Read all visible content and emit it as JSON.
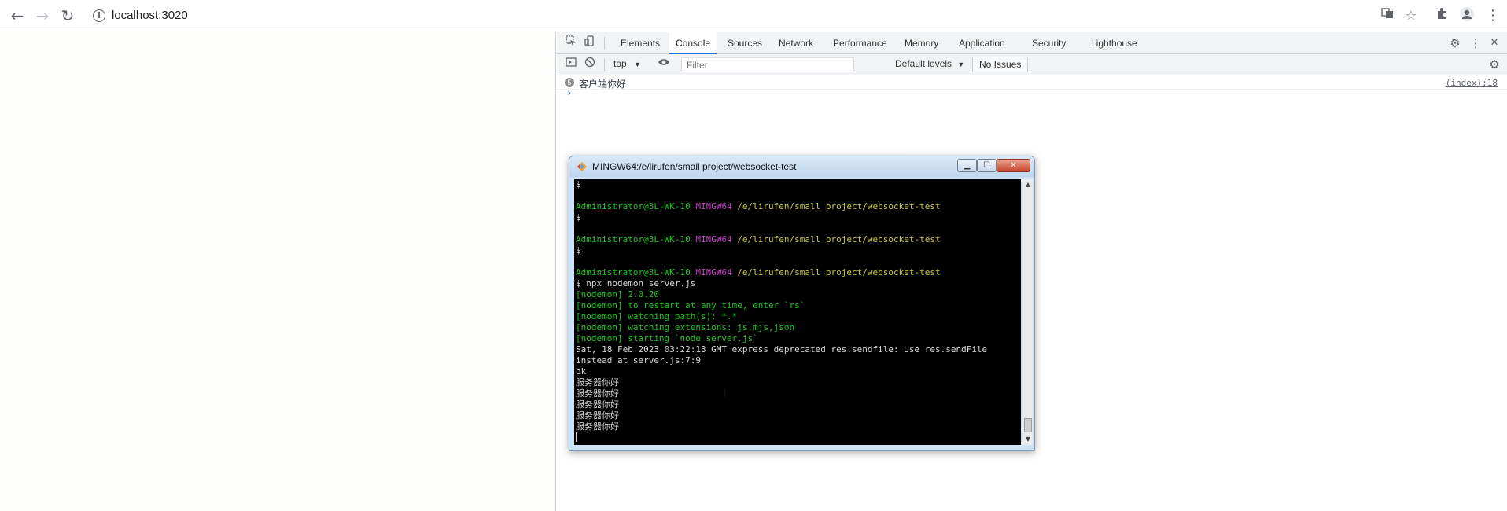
{
  "browser": {
    "url": "localhost:3020",
    "back_icon": "←",
    "forward_icon": "→",
    "reload_icon": "↻"
  },
  "devtools": {
    "tabs": [
      "Elements",
      "Console",
      "Sources",
      "Network",
      "Performance",
      "Memory",
      "Application",
      "Security",
      "Lighthouse"
    ],
    "active_tab": "Console",
    "context": "top",
    "filter_placeholder": "Filter",
    "levels": "Default levels",
    "issues": "No Issues",
    "console_messages": [
      {
        "count": "5",
        "text": "客户端你好",
        "source": "(index):18"
      }
    ],
    "prompt": "›"
  },
  "terminal": {
    "title": "MINGW64:/e/lirufen/small project/websocket-test",
    "prompt_user": "Administrator@3L-WK-10",
    "prompt_shell": "MINGW64",
    "prompt_path": "/e/lirufen/small project/websocket-test",
    "lines": {
      "l01": "$",
      "l03": "$",
      "l05": "$",
      "l07": "$ npx nodemon server.js",
      "l08": "[nodemon] 2.0.20",
      "l09": "[nodemon] to restart at any time, enter `rs`",
      "l10": "[nodemon] watching path(s): *.*",
      "l11": "[nodemon] watching extensions: js,mjs,json",
      "l12": "[nodemon] starting `node server.js`",
      "l13": "Sat, 18 Feb 2023 03:22:13 GMT express deprecated res.sendfile: Use res.sendFile",
      "l14": "instead at server.js:7:9",
      "l15": "ok",
      "l16": "服务器你好",
      "l17": "服务器你好",
      "l18": "服务器你好",
      "l19": "服务器你好",
      "l20": "服务器你好"
    }
  }
}
